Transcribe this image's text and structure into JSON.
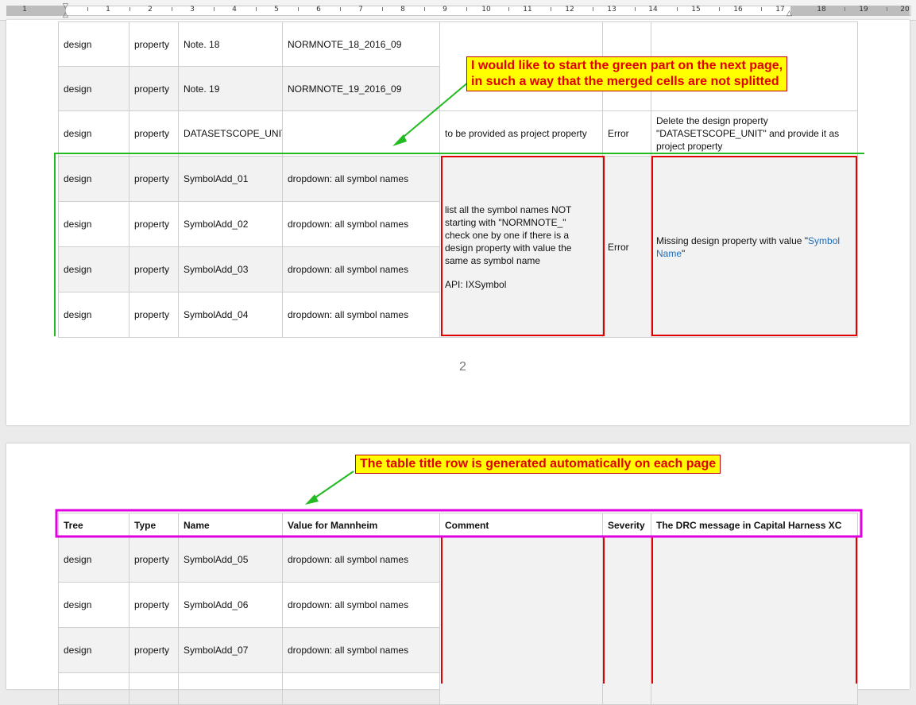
{
  "ruler": {
    "numbers": [
      "1",
      "1",
      "2",
      "3",
      "4",
      "5",
      "6",
      "7",
      "8",
      "9",
      "10",
      "11",
      "12",
      "13",
      "14",
      "15",
      "16",
      "17",
      "18",
      "19",
      "20"
    ]
  },
  "page1": {
    "page_number": "2",
    "rows_top": [
      {
        "tree": "design",
        "type": "property",
        "name": "Note. 18",
        "value": "NORMNOTE_18_2016_09"
      },
      {
        "tree": "design",
        "type": "property",
        "name": "Note. 19",
        "value": "NORMNOTE_19_2016_09"
      }
    ],
    "row_scope": {
      "tree": "design",
      "type": "property",
      "name": "DATASETSCOPE_UNIT",
      "value": "",
      "comment": "to be provided as project property",
      "severity": "Error",
      "message": "Delete the design property \"DATASETSCOPE_UNIT\" and provide it as project property"
    },
    "green_rows": [
      {
        "tree": "design",
        "type": "property",
        "name": "SymbolAdd_01",
        "value": "dropdown: all symbol names"
      },
      {
        "tree": "design",
        "type": "property",
        "name": "SymbolAdd_02",
        "value": "dropdown: all symbol names"
      },
      {
        "tree": "design",
        "type": "property",
        "name": "SymbolAdd_03",
        "value": "dropdown: all symbol names"
      },
      {
        "tree": "design",
        "type": "property",
        "name": "SymbolAdd_04",
        "value": "dropdown: all symbol names"
      }
    ],
    "merged_comment": [
      "list all the symbol names NOT",
      "starting with \"NORMNOTE_\"",
      "check one by one if there is a",
      "design property with value the",
      "same as symbol name",
      "",
      "API: IXSymbol"
    ],
    "merged_severity": "Error",
    "merged_message_prefix": "Missing design property with value \"",
    "merged_message_link": "Symbol Name",
    "merged_message_suffix": "\""
  },
  "page2": {
    "headers": [
      "Tree",
      "Type",
      "Name",
      "Value for Mannheim",
      "Comment",
      "Severity",
      "The DRC message in Capital Harness XC"
    ],
    "rows": [
      {
        "tree": "design",
        "type": "property",
        "name": "SymbolAdd_05",
        "value": "dropdown: all symbol names"
      },
      {
        "tree": "design",
        "type": "property",
        "name": "SymbolAdd_06",
        "value": "dropdown: all symbol names"
      },
      {
        "tree": "design",
        "type": "property",
        "name": "SymbolAdd_07",
        "value": "dropdown: all symbol names"
      }
    ]
  },
  "annotations": {
    "callout1_line1": "I would like to start the green part on the next page,",
    "callout1_line2": "in such a way that the merged cells are not splitted",
    "callout2": "The table title row is generated automatically on each page"
  },
  "colors": {
    "green": "#22bb22",
    "red": "#e00000",
    "magenta": "#e000e0",
    "callout_bg": "#ffff00",
    "link": "#1e6bb8"
  }
}
